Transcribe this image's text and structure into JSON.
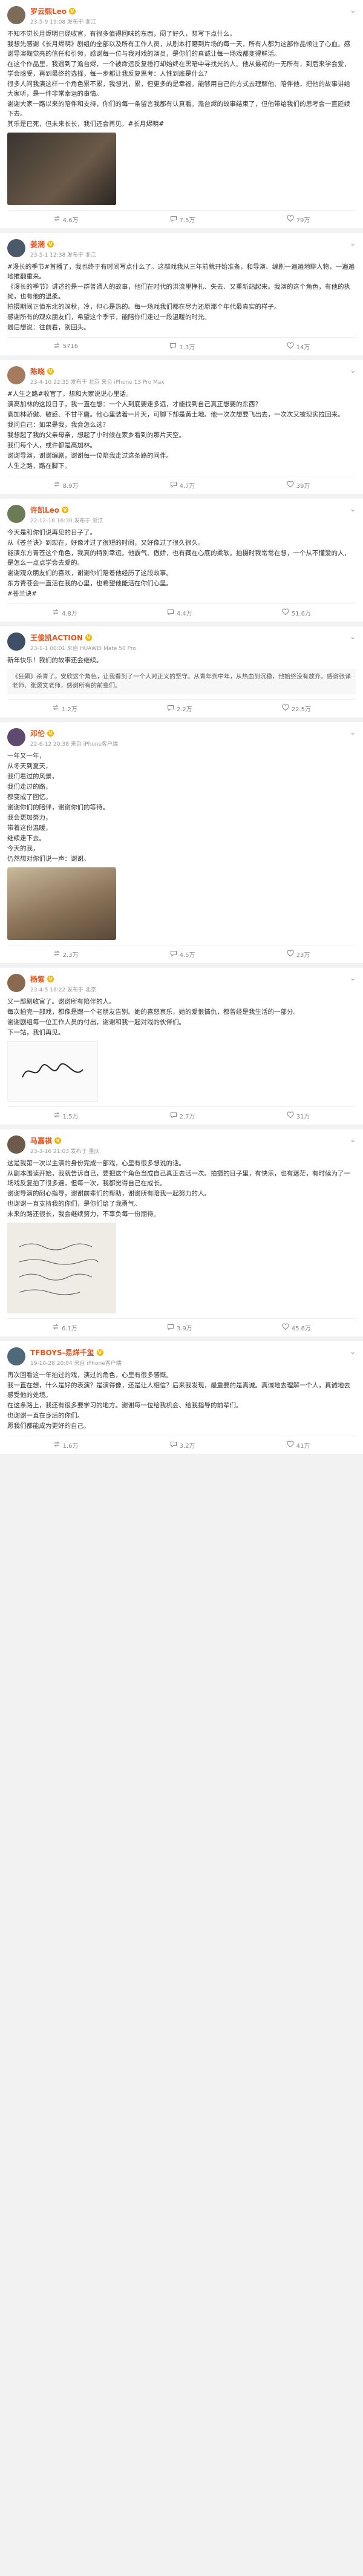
{
  "posts": [
    {
      "user": "罗云熙Leo",
      "info": "23-5-9 19:08 发布于 浙江",
      "paras": [
        "不知不觉长月烬明已经收官，有很多值得回味的东西，闷了好久，想写下点什么。",
        "我想先感谢《长月烬明》剧组的全部以及所有工作人员，从剧本打磨到片场的每一天，所有人都为这部作品倾注了心血。感谢导演鞠觉亮的信任和引领，感谢每一位与我对戏的演员，是你们的真诚让每一场戏都变得鲜活。",
        "在这个作品里，我遇到了澹台烬，一个被命运反复捶打却始终在黑暗中寻找光的人。他从最初的一无所有，到后来学会爱，学会感受，再到最终的选择，每一步都让我反复思考：人性到底是什么？",
        "很多人问我演这样一个角色累不累，我想说，累，但更多的是幸福。能够用自己的方式去理解他、陪伴他，把他的故事讲给大家听，是一件非常幸运的事情。",
        "谢谢大家一路以来的陪伴和支持，你们的每一条留言我都有认真看。澹台烬的故事结束了，但他带给我们的思考会一直延续下去。",
        "其乐是已死，但未来长长，我们还会再见。#长月烬明#"
      ],
      "reposts": "4.6万",
      "comments": "7.5万",
      "likes": "79万"
    },
    {
      "user": "姜潮",
      "info": "23-5-1 12:38 发布于 浙江",
      "paras": [
        "#漫长的季节#首播了，我也终于有时间写点什么了。这部戏我从三年前就开始准备，和导演、编剧一遍遍地聊人物，一遍遍地推翻重来。",
        "《漫长的季节》讲述的是一群普通人的故事，他们在时代的洪流里挣扎、失去、又重新站起来。我演的这个角色，有他的执拗，也有他的温柔。",
        "拍摄期间正值东北的深秋，冷，但心是热的。每一场戏我们都在尽力还原那个年代最真实的样子。",
        "感谢所有的观众朋友们，希望这个季节，能陪你们走过一段温暖的时光。",
        "最后想说：往前看，别回头。"
      ],
      "reposts": "5716",
      "comments": "1.3万",
      "likes": "14万"
    },
    {
      "user": "陈晓",
      "info": "23-4-10 22:35 发布于 北京 来自 iPhone 13 Pro Max",
      "paras": [
        "#人生之路#收官了，想和大家说说心里话。",
        "演高加林的这段日子，我一直在想：一个人到底要走多远，才能找到自己真正想要的东西？",
        "高加林骄傲、敏感、不甘平庸。他心里装着一片天，可脚下却是黄土地。他一次次想要飞出去，一次次又被现实拉回来。",
        "我问自己：如果是我，我会怎么选？",
        "我想起了我的父亲母亲，想起了小时候在家乡看到的那片天空。",
        "我们每个人，或许都是高加林。",
        "谢谢导演，谢谢编剧，谢谢每一位陪我走过这条路的同伴。",
        "人生之路，路在脚下。"
      ],
      "reposts": "8.9万",
      "comments": "4.7万",
      "likes": "39万"
    },
    {
      "user": "许凯Leo",
      "info": "22-12-18 16:30 发布于 浙江",
      "paras": [
        "今天是和你们说再见的日子了。",
        "从《苍兰诀》到现在，好像才过了很短的时间，又好像过了很久很久。",
        "能演东方青苍这个角色，我真的特别幸运。他霸气、傲娇，也有藏在心底的柔软。拍摄时我常常在想，一个从不懂爱的人，是怎么一点点学会去爱的。",
        "谢谢观众朋友们的喜欢，谢谢你们陪着他经历了这段故事。",
        "东方青苍会一直活在我的心里，也希望他能活在你们心里。",
        "#苍兰诀#"
      ],
      "reposts": "4.8万",
      "comments": "4.4万",
      "likes": "51.6万"
    },
    {
      "user": "王俊凯ACTION",
      "info": "23-1-1 00:01 来自 HUAWEI Mate 50 Pro",
      "paras": [
        "新年快乐！我们的故事还会继续。"
      ],
      "quote": "《狂飙》杀青了。安欣这个角色，让我看到了一个人对正义的坚守。从青年到中年，从热血到沉稳，他始终没有放弃。感谢张译老师、张颂文老师，感谢所有的前辈们。",
      "reposts": "1.2万",
      "comments": "2.2万",
      "likes": "22.5万"
    },
    {
      "user": "邓伦",
      "info": "22-6-12 20:38 来自 iPhone客户端",
      "paras": [
        "一年又一年，",
        "从冬天到夏天，",
        "我们看过的风景，",
        "我们走过的路，",
        "都变成了回忆。",
        "谢谢你们的陪伴，谢谢你们的等待。",
        "我会更加努力，",
        "带着这份温暖，",
        "继续走下去。",
        "今天的我，",
        "仍然想对你们说一声：谢谢。"
      ],
      "reposts": "2.3万",
      "comments": "4.5万",
      "likes": "23万"
    },
    {
      "user": "杨紫",
      "info": "23-4-5 18:22 发布于 北京",
      "paras": [
        "又一部剧收官了。谢谢所有陪伴的人。",
        "每次拍完一部戏，都像是跟一个老朋友告别。她的喜怒哀乐，她的爱恨情仇，都曾经是我生活的一部分。",
        "谢谢剧组每一位工作人员的付出，谢谢和我一起对戏的伙伴们。",
        "下一站，我们再见。"
      ],
      "reposts": "1.5万",
      "comments": "2.7万",
      "likes": "31万"
    },
    {
      "user": "马嘉祺",
      "info": "23-3-16 21:03 发布于 重庆",
      "paras": [
        "这是我第一次以主演的身份完成一部戏，心里有很多想说的话。",
        "从剧本围读开始，我就告诉自己，要把这个角色当成自己真正去活一次。拍摄的日子里，有快乐，也有迷茫，有时候为了一场戏反复拍了很多遍，但每一次，我都觉得自己在成长。",
        "谢谢导演的耐心指导，谢谢前辈们的帮助，谢谢所有陪我一起努力的人。",
        "也谢谢一直支持我的你们，是你们给了我勇气。",
        "未来的路还很长，我会继续努力，不辜负每一份期待。"
      ],
      "reposts": "6.1万",
      "comments": "3.9万",
      "likes": "45.6万"
    },
    {
      "user": "TFBOYS-易烊千玺",
      "info": "19-10-28 20:04 来自 iPhone客户端",
      "paras": [
        "再次回看这一年拍过的戏，演过的角色，心里有很多感慨。",
        "我一直在想，什么是好的表演？是演得像，还是让人相信？后来我发现，最重要的是真诚。真诚地去理解一个人，真诚地去感受他的处境。",
        "在这条路上，我还有很多要学习的地方。谢谢每一位给我机会、给我指导的前辈们。",
        "也谢谢一直在身后的你们。",
        "愿我们都能成为更好的自己。"
      ],
      "reposts": "1.6万",
      "comments": "3.2万",
      "likes": "41万"
    }
  ],
  "colors": {
    "accent": "#e8541e",
    "tag": "#eb7350",
    "link": "#507daf",
    "muted": "#999999"
  }
}
